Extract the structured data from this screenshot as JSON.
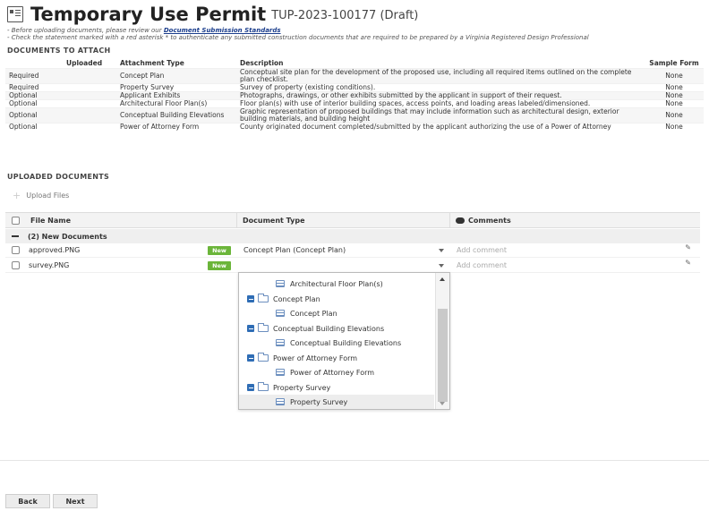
{
  "header": {
    "title": "Temporary Use Permit",
    "record_id": "TUP-2023-100177 (Draft)"
  },
  "notes": {
    "line1_prefix": "- Before uploading documents, please review our ",
    "line1_link": "Document Submission Standards",
    "line2": "- Check the statement marked with a red asterisk * to authenticate any submitted construction documents that are required to be prepared by a Virginia Registered Design Professional"
  },
  "attach_section": {
    "title": "DOCUMENTS TO ATTACH",
    "headers": {
      "required": "",
      "uploaded": "Uploaded",
      "type": "Attachment Type",
      "description": "Description",
      "sample": "Sample Form"
    },
    "rows": [
      {
        "required": "Required",
        "type": "Concept Plan",
        "description": "Conceptual site plan for the development of the proposed use, including all required items outlined on the complete plan checklist.",
        "sample": "None"
      },
      {
        "required": "Required",
        "type": "Property Survey",
        "description": "Survey of property (existing conditions).",
        "sample": "None"
      },
      {
        "required": "Optional",
        "type": "Applicant Exhibits",
        "description": "Photographs, drawings, or other exhibits submitted by the applicant in support of their request.",
        "sample": "None"
      },
      {
        "required": "Optional",
        "type": "Architectural Floor Plan(s)",
        "description": "Floor plan(s) with use of interior building spaces, access points, and loading areas labeled/dimensioned.",
        "sample": "None"
      },
      {
        "required": "Optional",
        "type": "Conceptual Building Elevations",
        "description": "Graphic representation of proposed buildings that may include information such as architectural design, exterior building materials, and building height",
        "sample": "None"
      },
      {
        "required": "Optional",
        "type": "Power of Attorney Form",
        "description": "County originated document completed/submitted by the applicant authorizing the use of a Power of Attorney",
        "sample": "None"
      }
    ]
  },
  "uploaded_section": {
    "title": "UPLOADED DOCUMENTS",
    "upload_button": "Upload Files",
    "columns": {
      "file_name": "File Name",
      "document_type": "Document Type",
      "comments": "Comments"
    },
    "group_label": "(2) New Documents",
    "files": [
      {
        "name": "approved.PNG",
        "badge": "New",
        "doc_type": "Concept Plan (Concept Plan)",
        "comment_placeholder": "Add comment"
      },
      {
        "name": "survey.PNG",
        "badge": "New",
        "doc_type": "",
        "comment_placeholder": "Add comment"
      }
    ]
  },
  "dropdown": {
    "items": [
      {
        "kind": "leaf",
        "label": "Architectural Floor Plan(s)"
      },
      {
        "kind": "folder",
        "label": "Concept Plan"
      },
      {
        "kind": "leaf",
        "label": "Concept Plan"
      },
      {
        "kind": "folder",
        "label": "Conceptual Building Elevations"
      },
      {
        "kind": "leaf",
        "label": "Conceptual Building Elevations"
      },
      {
        "kind": "folder",
        "label": "Power of Attorney Form"
      },
      {
        "kind": "leaf",
        "label": "Power of Attorney Form"
      },
      {
        "kind": "folder",
        "label": "Property Survey"
      },
      {
        "kind": "leaf",
        "label": "Property Survey",
        "selected": true
      }
    ]
  },
  "footer": {
    "back_label": "Back",
    "next_label": "Next"
  },
  "colors": {
    "new_badge": "#6bb53a",
    "link": "#1a3d8c",
    "tree_expander": "#2f6db5"
  }
}
